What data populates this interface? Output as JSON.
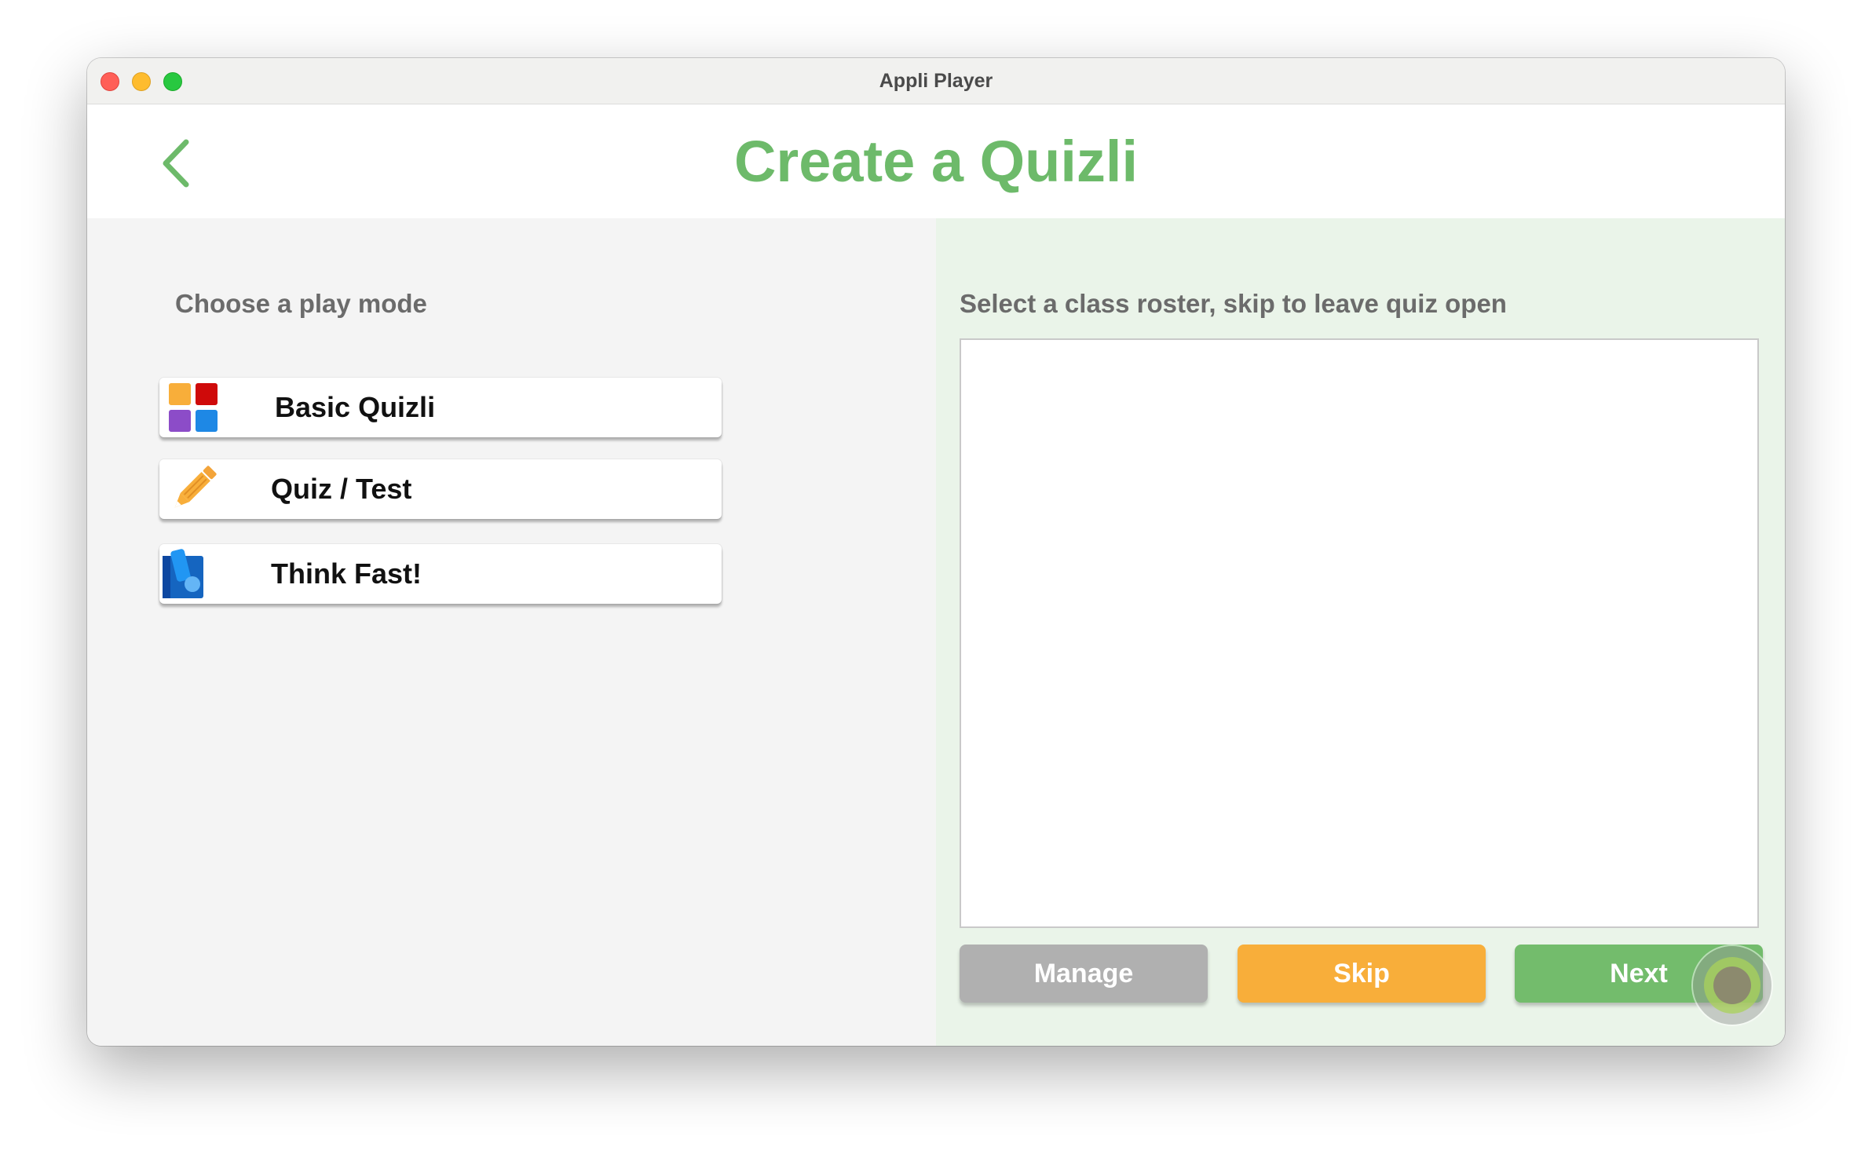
{
  "window": {
    "title": "Appli Player"
  },
  "header": {
    "back_icon": "chevron-left-icon",
    "title": "Create a Quizli",
    "accent_color": "#6dba6a"
  },
  "play_mode": {
    "heading": "Choose a play mode",
    "modes": [
      {
        "label": "Basic Quizli",
        "icon": "colored-squares-icon"
      },
      {
        "label": "Quiz / Test",
        "icon": "pencil-icon"
      },
      {
        "label": "Think Fast!",
        "icon": "fast-blocks-icon"
      }
    ]
  },
  "roster": {
    "heading": "Select a class roster, skip to leave quiz open",
    "items": []
  },
  "actions": {
    "manage_label": "Manage",
    "skip_label": "Skip",
    "next_label": "Next",
    "manage_color": "#b0b0b0",
    "skip_color": "#f8ae3a",
    "next_color": "#73bc6c"
  }
}
